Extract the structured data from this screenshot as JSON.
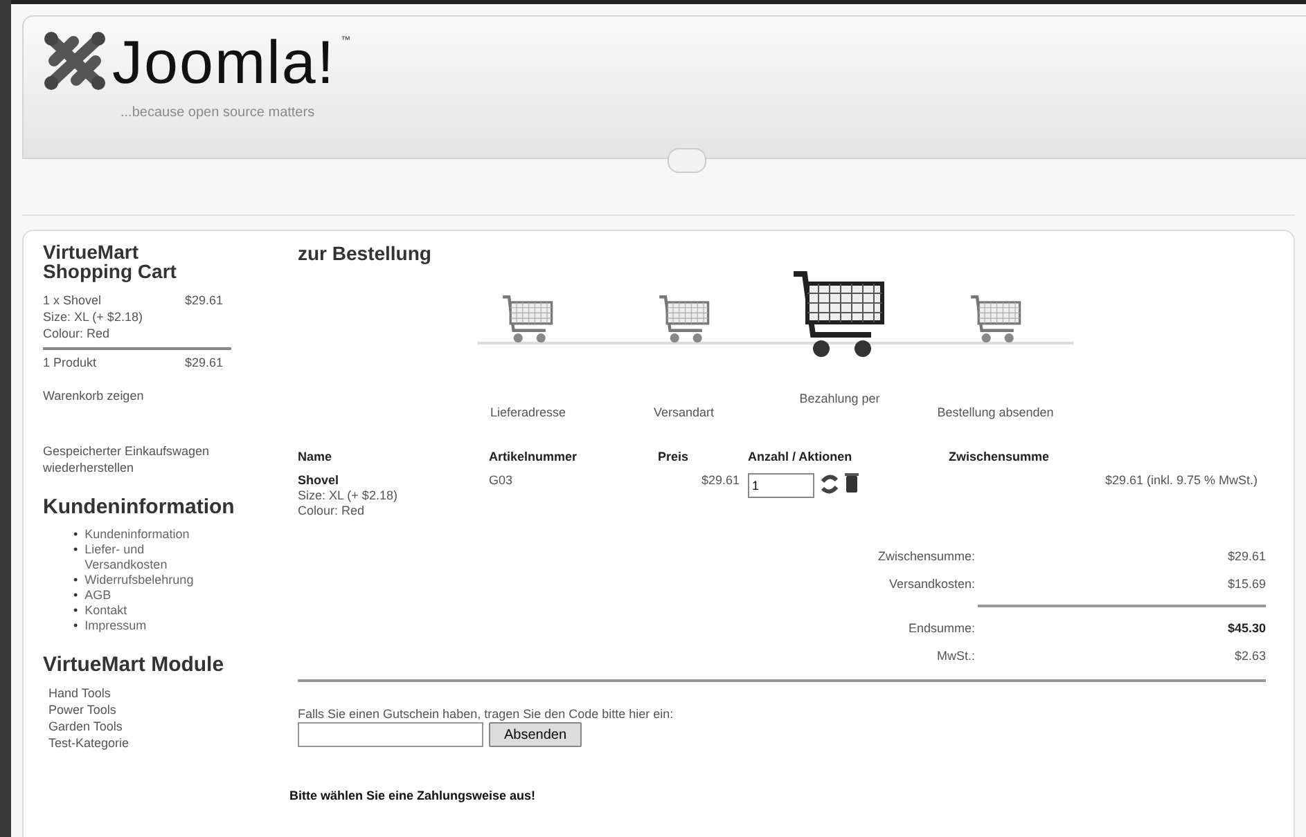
{
  "header": {
    "logo_text": "Joomla!",
    "trademark": "™",
    "tagline": "...because open source matters"
  },
  "cart_module": {
    "title": "VirtueMart Shopping Cart",
    "item": {
      "line": "1 x Shovel",
      "price": "$29.61",
      "details": [
        "Size: XL (+ $2.18)",
        "Colour: Red"
      ]
    },
    "summary": {
      "count": "1 Produkt",
      "total": "$29.61"
    },
    "show_link": "Warenkorb zeigen",
    "restore_link": "Gespeicherter Einkaufswagen wiederherstellen"
  },
  "info_module": {
    "title": "Kundeninformation",
    "bullet": "•",
    "items": [
      "Kundeninformation",
      "Liefer- und Versandkosten",
      "Widerrufsbelehrung",
      "AGB",
      "Kontakt",
      "Impressum"
    ]
  },
  "vm_module": {
    "title": "VirtueMart Module",
    "items": [
      "Hand Tools",
      "Power Tools",
      "Garden Tools",
      "Test-Kategorie"
    ]
  },
  "page_title": "zur Bestellung",
  "steps": [
    {
      "label": "Lieferadresse",
      "selected": false
    },
    {
      "label": "Versandart",
      "selected": false
    },
    {
      "label": "Bezahlung per",
      "selected": true
    },
    {
      "label": "Bestellung absenden",
      "selected": false
    }
  ],
  "table": {
    "columns": [
      "Name",
      "Artikelnummer",
      "Preis",
      "Anzahl / Aktionen",
      "Zwischensumme"
    ],
    "rows": [
      {
        "name": "Shovel",
        "details": [
          "Size: XL (+ $2.18)",
          "Colour: Red"
        ],
        "sku": "G03",
        "price": "$29.61",
        "quantity": "1",
        "subtotal": "$29.61 (inkl. 9.75 % MwSt.)"
      }
    ]
  },
  "totals": [
    {
      "label": "Zwischensumme:",
      "value": "$29.61",
      "bold": false
    },
    {
      "label": "Versandkosten:",
      "value": "$15.69",
      "bold": false,
      "rule_after": true
    },
    {
      "label": "Endsumme:",
      "value": "$45.30",
      "bold": true
    },
    {
      "label": "MwSt.:",
      "value": "$2.63",
      "bold": false
    }
  ],
  "coupon": {
    "prompt": "Falls Sie einen Gutschein haben, tragen Sie den Code bitte hier ein:",
    "button": "Absenden"
  },
  "payment_prompt": "Bitte wählen Sie eine Zahlungsweise aus!"
}
